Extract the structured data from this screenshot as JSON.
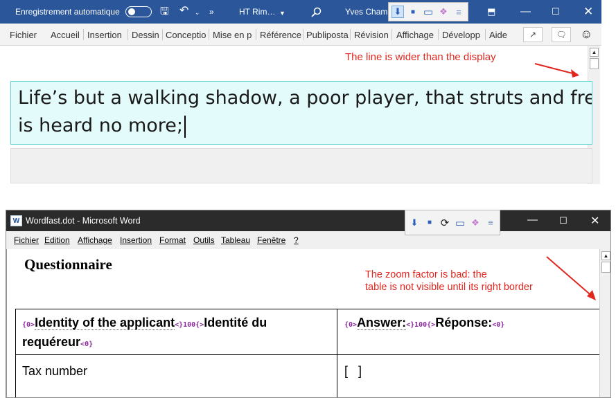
{
  "top_window": {
    "autosave_label": "Enregistrement automatique",
    "doc_title": "HT Rim…",
    "user_name": "Yves Champ",
    "tabs": [
      "Fichier",
      "Accueil",
      "Insertion",
      "Dessin",
      "Conceptio",
      "Mise en p",
      "Référence",
      "Publiposta",
      "Révision",
      "Affichage",
      "Développ",
      "Aide"
    ],
    "text_line1": "Life’s but a walking shadow, a poor player, that struts and frets",
    "text_line2": "is heard no more;",
    "annotation": "The line is wider than the display"
  },
  "bottom_window": {
    "title": "Wordfast.dot - Microsoft Word",
    "menu": [
      "Fichier",
      "Edition",
      "Affichage",
      "Insertion",
      "Format",
      "Outils",
      "Tableau",
      "Fenêtre",
      "?"
    ],
    "heading": "Questionnaire",
    "annotation_line1": "The zoom factor is bad: the",
    "annotation_line2": "table is not visible until its right border",
    "table": {
      "header_left": {
        "tag_open": "{0>",
        "text1": "Identity of the applicant",
        "tag_mid": "<}100{>",
        "text2": "Identité du",
        "text3": "requéreur",
        "tag_close": "<0}"
      },
      "header_right": {
        "tag_open": "{0>",
        "text1": "Answer:",
        "tag_mid": "<}100{>",
        "text2": "Réponse:",
        "tag_close": "<0}"
      },
      "row1_left": "Tax number",
      "row1_right": "[   ]"
    }
  },
  "colors": {
    "title_blue": "#2b579a",
    "annotation_red": "#e0261e",
    "textbox_bg": "#e4fbfb"
  }
}
